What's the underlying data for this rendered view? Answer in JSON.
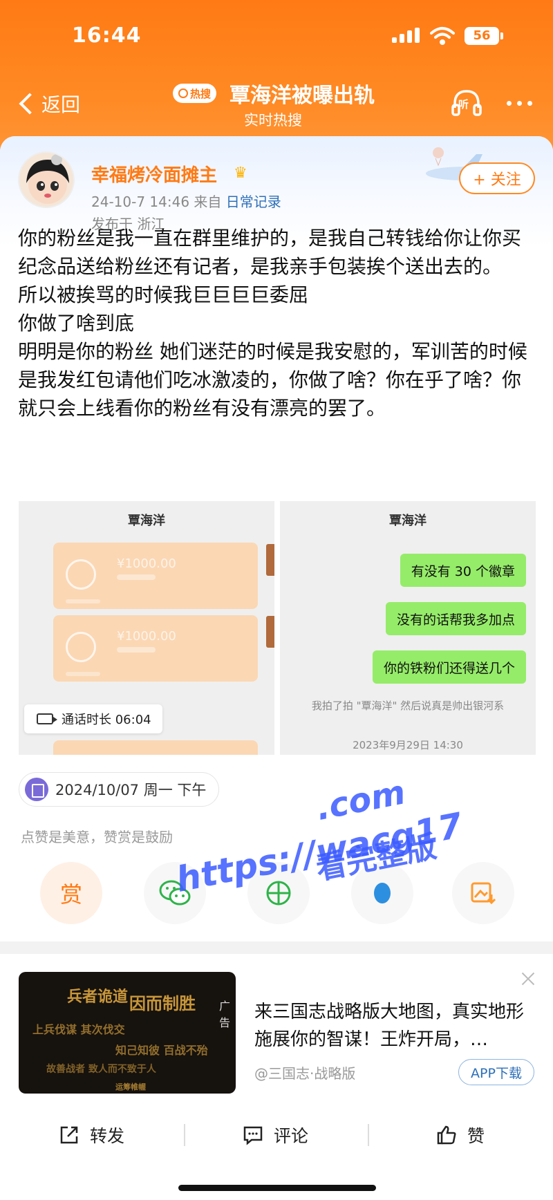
{
  "status_bar": {
    "time": "16:44",
    "battery": "56"
  },
  "nav": {
    "back_label": "返回",
    "hot_badge": "热搜",
    "title": "覃海洋被曝出轨",
    "subtitle": "实时热搜",
    "listen_label": "听"
  },
  "post": {
    "username": "幸福烤冷面摊主",
    "timestamp": "24-10-7 14:46",
    "source_prefix": "来自",
    "source": "日常记录",
    "location": "发布于 浙江",
    "follow_label": "+ 关注",
    "paragraphs": [
      "你的粉丝是我一直在群里维护的，是我自己转钱给你让你买纪念品送给粉丝还有记者，是我亲手包装挨个送出去的。",
      "所以被挨骂的时候我巨巨巨巨委屈",
      "你做了啥到底",
      "明明是你的粉丝 她们迷茫的时候是我安慰的，军训苦的时候是我发红包请他们吃冰激凌的，你做了啥？你在乎了啥？你就只会上线看你的粉丝有没有漂亮的罢了。"
    ],
    "images": {
      "left": {
        "title": "覃海洋",
        "payments": [
          "¥1000.00",
          "¥1000.00"
        ],
        "call_label": "通话时长 06:04"
      },
      "right": {
        "title": "覃海洋",
        "bubbles": [
          "有没有 30 个徽章",
          "没有的话帮我多加点",
          "你的铁粉们还得送几个"
        ],
        "note": "我拍了拍 \"覃海洋\" 然后说真是帅出银河系",
        "date": "2023年9月29日 14:30"
      }
    },
    "date_pill": "2024/10/07 周一 下午",
    "encourage": "点赞是美意，赞赏是鼓励",
    "reward_label": "赏"
  },
  "watermark": {
    "url": "https://wacg17.com",
    "url_part1": ".com",
    "url_part2": "https://wacg17",
    "tagline": "看完整版"
  },
  "ad": {
    "tag": "广告",
    "text": "来三国志战略版大地图，真实地形施展你的智谋！王炸开局，…",
    "source": "@三国志·战略版",
    "button": "APP下载"
  },
  "bottom_bar": {
    "repost": "转发",
    "comment": "评论",
    "like": "赞"
  },
  "colors": {
    "accent": "#ff7a14",
    "link": "#2d6fb7",
    "wechat_green": "#95ec69",
    "watermark": "#3b5bff"
  }
}
